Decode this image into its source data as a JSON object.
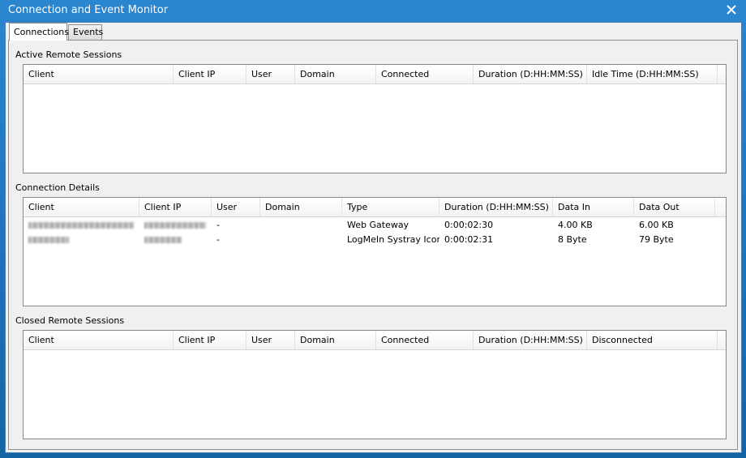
{
  "window": {
    "title": "Connection and Event Monitor"
  },
  "tabs": [
    {
      "label": "Connections",
      "active": true
    },
    {
      "label": "Events",
      "active": false
    }
  ],
  "active_sessions": {
    "title": "Active Remote Sessions",
    "columns": [
      "Client",
      "Client IP",
      "User",
      "Domain",
      "Connected",
      "Duration (D:HH:MM:SS)",
      "Idle Time (D:HH:MM:SS)"
    ]
  },
  "connection_details": {
    "title": "Connection Details",
    "columns": [
      "Client",
      "Client IP",
      "User",
      "Domain",
      "Type",
      "Duration (D:HH:MM:SS)",
      "Data In",
      "Data Out"
    ],
    "rows": [
      {
        "user": "-",
        "domain": "",
        "type": "Web Gateway",
        "duration": "0:00:02:30",
        "data_in": "4.00 KB",
        "data_out": "6.00 KB"
      },
      {
        "user": "-",
        "domain": "",
        "type": "LogMeIn Systray Icon",
        "duration": "0:00:02:31",
        "data_in": "8 Byte",
        "data_out": "79 Byte"
      }
    ]
  },
  "closed_sessions": {
    "title": "Closed Remote Sessions",
    "columns": [
      "Client",
      "Client IP",
      "User",
      "Domain",
      "Connected",
      "Duration (D:HH:MM:SS)",
      "Disconnected"
    ]
  }
}
